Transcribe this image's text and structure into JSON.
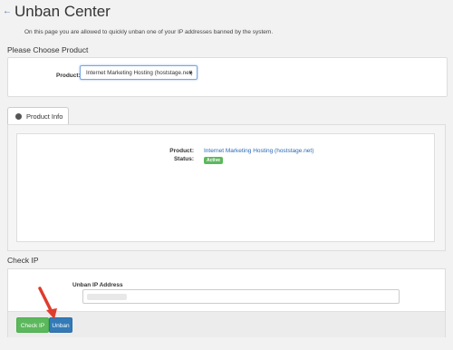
{
  "page": {
    "title": "Unban Center",
    "description": "On this page you are allowed to quickly unban one of your IP addresses banned by the system."
  },
  "choose_product": {
    "section_title": "Please Choose Product",
    "label": "Product:",
    "selected": "Internet Marketing Hosting (hoststage.net)"
  },
  "product_info": {
    "tab_label": "Product Info",
    "product_label": "Product:",
    "product_value": "Internet Marketing Hosting (hoststage.net)",
    "status_label": "Status:",
    "status_value": "Active",
    "status_color": "#5cb85c"
  },
  "check_ip": {
    "section_title": "Check IP",
    "field_label": "Unban IP Address",
    "check_button": "Check IP",
    "unban_button": "Unban"
  },
  "colors": {
    "primary": "#337ab7",
    "success": "#5cb85c",
    "arrow": "#e03c2c"
  }
}
